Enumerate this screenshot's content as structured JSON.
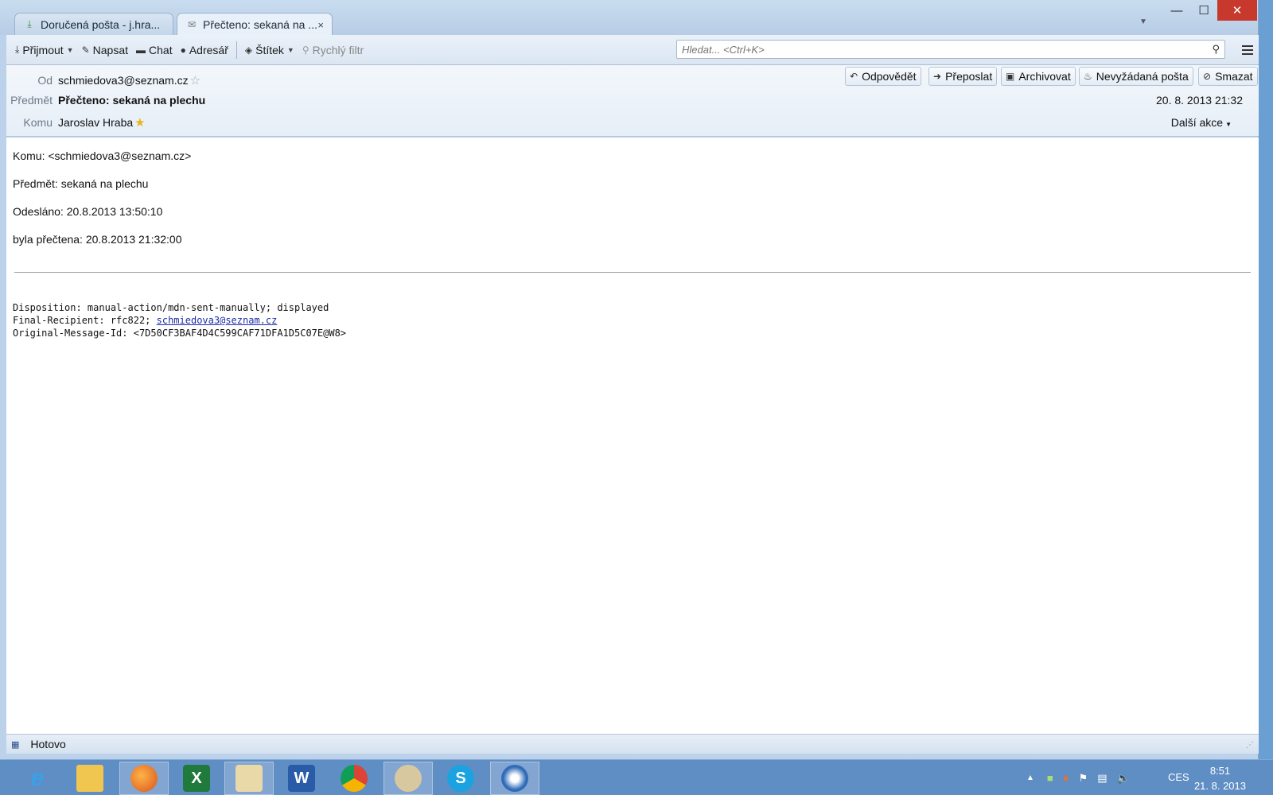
{
  "tabs": [
    {
      "label": "Doručená pošta - j.hra...",
      "icon": "inbox-download-icon",
      "active": false
    },
    {
      "label": "Přečteno: sekaná na ...",
      "icon": "envelope-icon",
      "active": true,
      "close": "×"
    }
  ],
  "window": {
    "minimize": "—",
    "maximize": "☐",
    "close": "✕"
  },
  "toolbar": {
    "receive": "Přijmout",
    "compose": "Napsat",
    "chat": "Chat",
    "addressbook": "Adresář",
    "tag": "Štítek",
    "quickfilter": "Rychlý filtr",
    "search_placeholder": "Hledat... <Ctrl+K>"
  },
  "header": {
    "from_label": "Od",
    "from_value": "schmiedova3@seznam.cz",
    "subject_label": "Předmět",
    "subject_value": "Přečteno: sekaná na plechu",
    "to_label": "Komu",
    "to_value": "Jaroslav Hraba",
    "date": "20. 8. 2013 21:32",
    "more_actions": "Další akce",
    "actions": {
      "reply": "Odpovědět",
      "forward": "Přeposlat",
      "archive": "Archivovat",
      "junk": "Nevyžádaná pošta",
      "delete": "Smazat"
    }
  },
  "body": {
    "lines": [
      "Komu: <schmiedova3@seznam.cz>",
      "Předmět: sekaná na plechu",
      "Odesláno: 20.8.2013 13:50:10",
      "byla přečtena: 20.8.2013 21:32:00"
    ],
    "disposition": "Disposition: manual-action/mdn-sent-manually; displayed",
    "final_recipient_prefix": "Final-Recipient: rfc822; ",
    "final_recipient_link": "schmiedova3@seznam.cz",
    "original_message_id": "Original-Message-Id: <7D50CF3BAF4D4C599CAF71DFA1D5C07E@W8>"
  },
  "status": {
    "text": "Hotovo"
  },
  "taskbar": {
    "apps": [
      "Internet Explorer",
      "Průzkumník",
      "Firefox",
      "Excel",
      "Prohlížeč",
      "Word",
      "Chrome",
      "Malování",
      "Skype",
      "Thunderbird"
    ],
    "language": "CES",
    "time": "8:51",
    "date": "21. 8. 2013"
  }
}
